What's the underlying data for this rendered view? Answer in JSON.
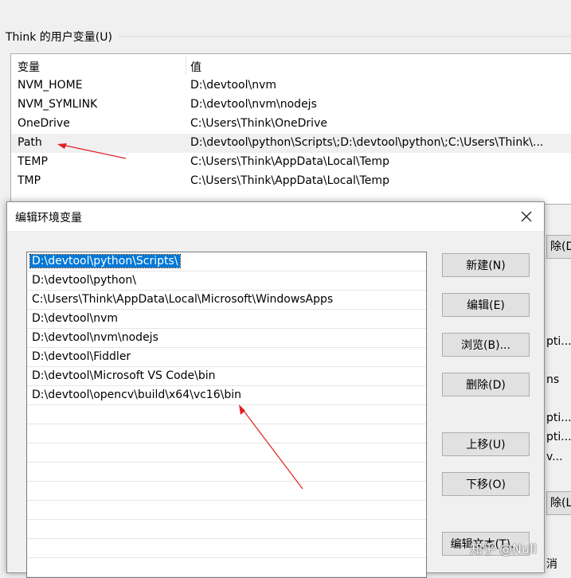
{
  "parent": {
    "user_vars_label": "Think 的用户变量(U)",
    "columns": {
      "name": "变量",
      "value": "值"
    },
    "rows": [
      {
        "name": "NVM_HOME",
        "value": "D:\\devtool\\nvm"
      },
      {
        "name": "NVM_SYMLINK",
        "value": "D:\\devtool\\nvm\\nodejs"
      },
      {
        "name": "OneDrive",
        "value": "C:\\Users\\Think\\OneDrive"
      },
      {
        "name": "Path",
        "value": "D:\\devtool\\python\\Scripts\\;D:\\devtool\\python\\;C:\\Users\\Think\\..."
      },
      {
        "name": "TEMP",
        "value": "C:\\Users\\Think\\AppData\\Local\\Temp"
      },
      {
        "name": "TMP",
        "value": "C:\\Users\\Think\\AppData\\Local\\Temp"
      }
    ],
    "selected_row": "Path",
    "peek": {
      "delete_user_btn": "除(D)",
      "text1": "pti...",
      "text2": "ns",
      "text3": "pti...",
      "text4": "pti...",
      "text5": "v...",
      "delete_sys_btn": "除(L)",
      "cancel_text": "消"
    }
  },
  "dialog": {
    "title": "编辑环境变量",
    "close_glyph": "✕",
    "paths": [
      "D:\\devtool\\python\\Scripts\\",
      "D:\\devtool\\python\\",
      "C:\\Users\\Think\\AppData\\Local\\Microsoft\\WindowsApps",
      "D:\\devtool\\nvm",
      "D:\\devtool\\nvm\\nodejs",
      "D:\\devtool\\Fiddler",
      "D:\\devtool\\Microsoft VS Code\\bin",
      "D:\\devtool\\opencv\\build\\x64\\vc16\\bin"
    ],
    "selected_index": 0,
    "buttons": {
      "new": "新建(N)",
      "edit": "编辑(E)",
      "browse": "浏览(B)...",
      "delete": "删除(D)",
      "move_up": "上移(U)",
      "move_down": "下移(O)",
      "edit_text": "编辑文本(T)..."
    }
  },
  "watermark": "知乎 @Null",
  "colors": {
    "selection": "#0078d7",
    "arrow": "#e02020"
  }
}
